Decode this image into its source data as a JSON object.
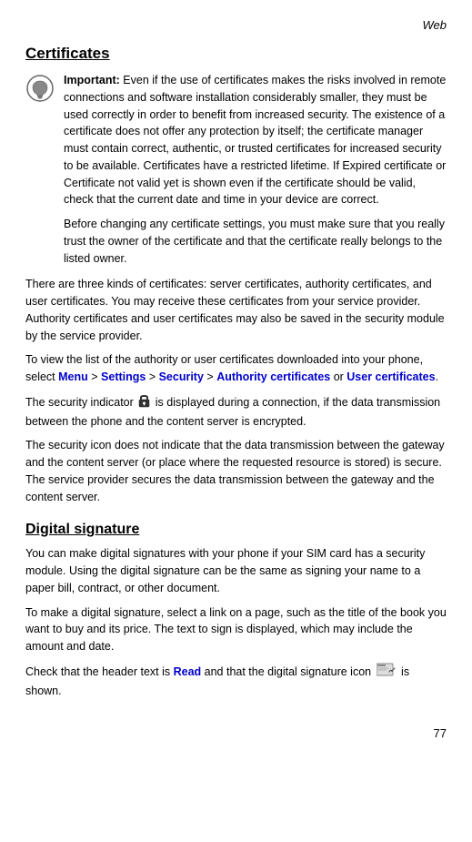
{
  "header": {
    "title": "Web"
  },
  "certificates": {
    "heading": "Certificates",
    "important_label": "Important:",
    "important_text1": " Even if the use of certificates makes the risks involved in remote connections and software installation considerably smaller, they must be used correctly in order to benefit from increased security. The existence of a certificate does not offer any protection by itself; the certificate manager must contain correct, authentic, or trusted certificates for increased security to be available. Certificates have a restricted lifetime. If Expired certificate or Certificate not valid yet is shown even if the certificate should be valid, check that the current date and time in your device are correct.",
    "important_text2": "Before changing any certificate settings, you must make sure that you really trust the owner of the certificate and that the certificate really belongs to the listed owner.",
    "para1": "There are three kinds of certificates: server certificates, authority certificates, and user certificates. You may receive these certificates from your service provider. Authority certificates and user certificates may also be saved in the security module by the service provider.",
    "para2_prefix": "To view the list of the authority or user certificates downloaded into your phone, select ",
    "menu_link": "Menu",
    "arrow1": " > ",
    "settings_link": "Settings",
    "arrow2": " > ",
    "security_link": "Security",
    "arrow3": " > ",
    "authority_link": "Authority certificates",
    "or_text": " or ",
    "user_link": "User certificates",
    "period": ".",
    "para3_prefix": "The security indicator ",
    "para3_suffix": " is displayed during a connection, if the data transmission between the phone and the content server is encrypted.",
    "para4": "The security icon does not indicate that the data transmission between the gateway and the content server (or place where the requested resource is stored) is secure. The service provider secures the data transmission between the gateway and the content server."
  },
  "digital_signature": {
    "heading": "Digital signature",
    "para1": "You can make digital signatures with your phone if your SIM card has a security module. Using the digital signature can be the same as signing your name to a paper bill, contract, or other document.",
    "para2": "To make a digital signature, select a link on a page, such as the title of the book you want to buy and its price. The text to sign is displayed, which may include the amount and date.",
    "para3_prefix": "Check that the header text is ",
    "read_link": "Read",
    "para3_suffix": " and that the digital signature icon ",
    "para3_end": " is shown."
  },
  "footer": {
    "page_number": "77"
  }
}
